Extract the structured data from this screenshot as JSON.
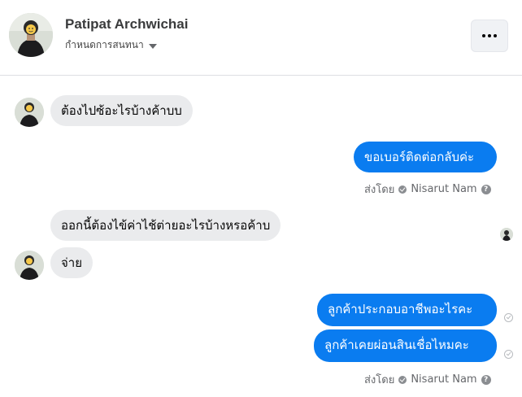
{
  "header": {
    "name": "Patipat Archwichai",
    "subtitle": "กำหนดการสนทนา",
    "menu_icon": "more-horizontal-icon"
  },
  "messages": [
    {
      "text": "ต้องไปซ้อะไรบ้างค้าบบ",
      "direction": "incoming"
    },
    {
      "text": "ขอเบอร์ติดต่อกลับค่ะ",
      "direction": "outgoing"
    },
    {
      "text": "ออกนี้ต้องไข้ค่าไช้ต่ายอะไรบ้างหรอค้าบ",
      "direction": "incoming"
    },
    {
      "text": "จ่าย",
      "direction": "incoming"
    },
    {
      "text": "ลูกค้าประกอบอาชีพอะไรคะ",
      "direction": "outgoing"
    },
    {
      "text": "ลูกค้าเคยผ่อนสินเชื่อไหมคะ",
      "direction": "outgoing"
    }
  ],
  "sent_by": {
    "prefix": "ส่งโดย",
    "name": "Nisarut Nam",
    "help": "?"
  },
  "colors": {
    "outgoing_bubble": "#0a7cf0",
    "incoming_bubble": "#eaebed"
  }
}
